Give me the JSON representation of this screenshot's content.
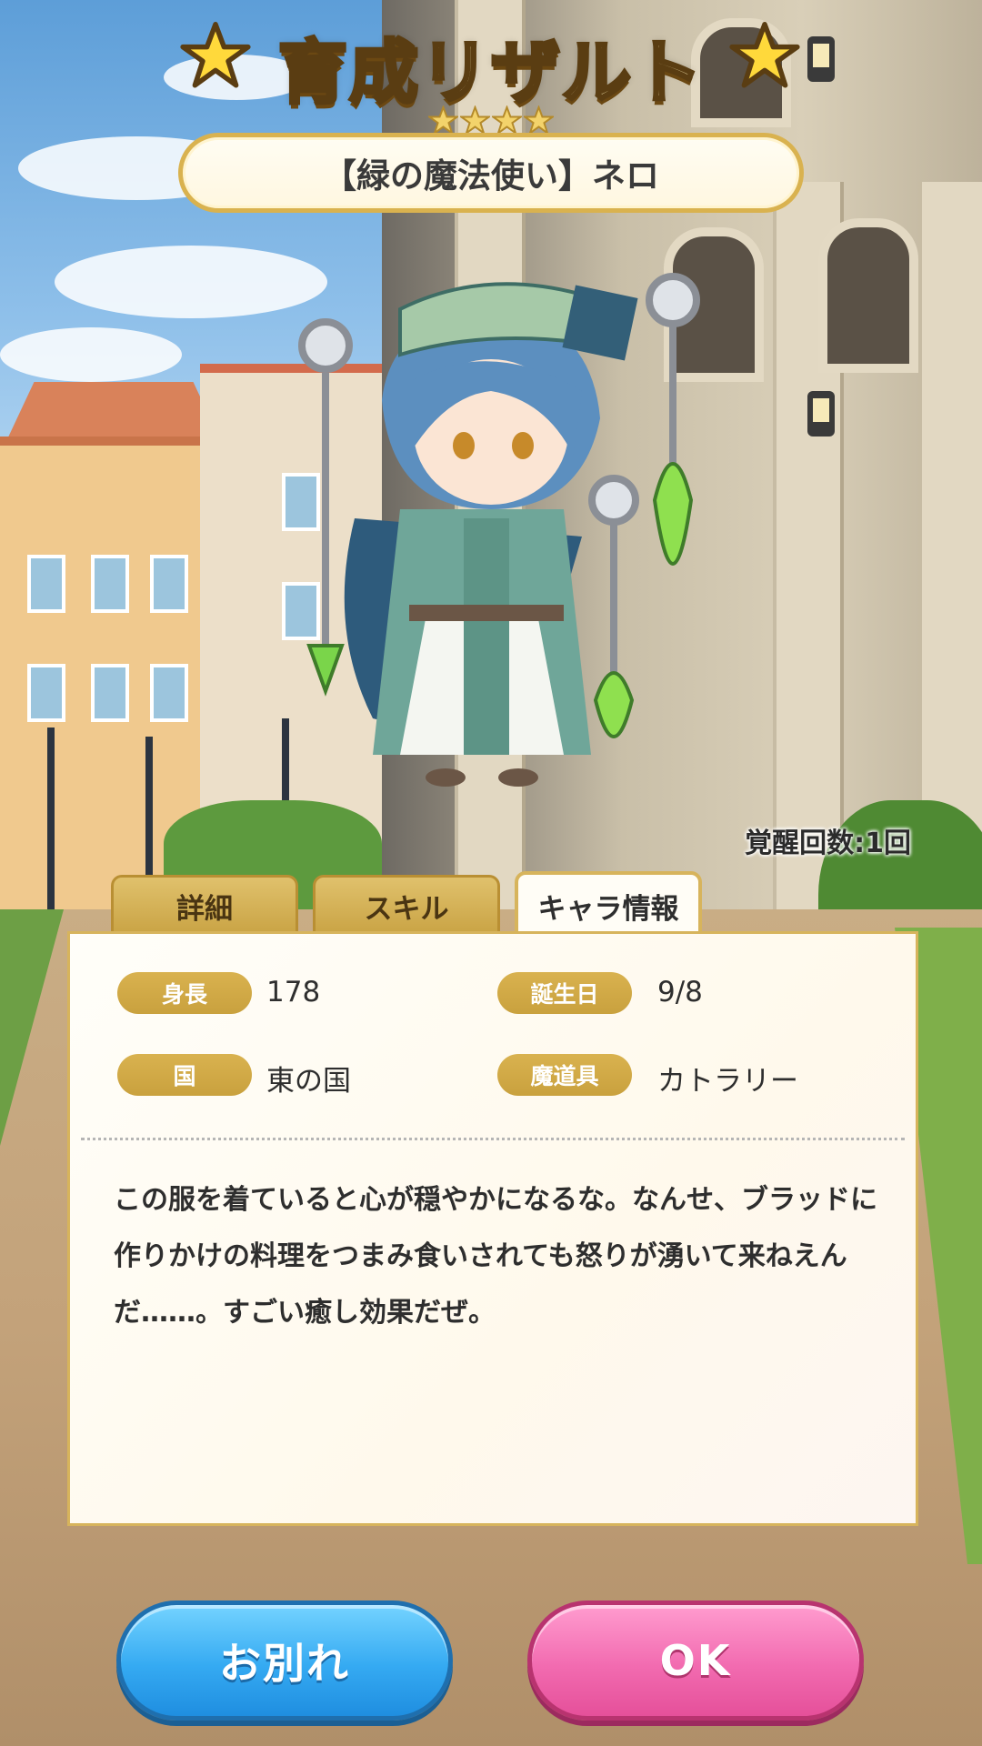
{
  "header": {
    "title": "育成リザルト",
    "rarity_stars": 4,
    "character_name": "【緑の魔法使い】ネロ"
  },
  "awakening": "覚醒回数:1回",
  "tabs": [
    {
      "label": "詳細",
      "active": false
    },
    {
      "label": "スキル",
      "active": false
    },
    {
      "label": "キャラ情報",
      "active": true
    }
  ],
  "profile": {
    "height_label": "身長",
    "height_value": "178",
    "birthday_label": "誕生日",
    "birthday_value": "9/8",
    "country_label": "国",
    "country_value": "東の国",
    "tool_label": "魔道具",
    "tool_value": "カトラリー",
    "description": "この服を着ていると心が穏やかになるな。なんせ、ブラッドに作りかけの料理をつまみ食いされても怒りが湧いて来ねえんだ……。すごい癒し効果だぜ。"
  },
  "buttons": {
    "farewell": "お別れ",
    "ok": "OK"
  },
  "colors": {
    "gold": "#d9b24f",
    "farewell_blue": "#35aaf2",
    "ok_pink": "#f26bb0",
    "panel_bg": "#fffdf6"
  },
  "icons": [
    "star-icon",
    "rarity-star-icon",
    "character-illustration"
  ]
}
